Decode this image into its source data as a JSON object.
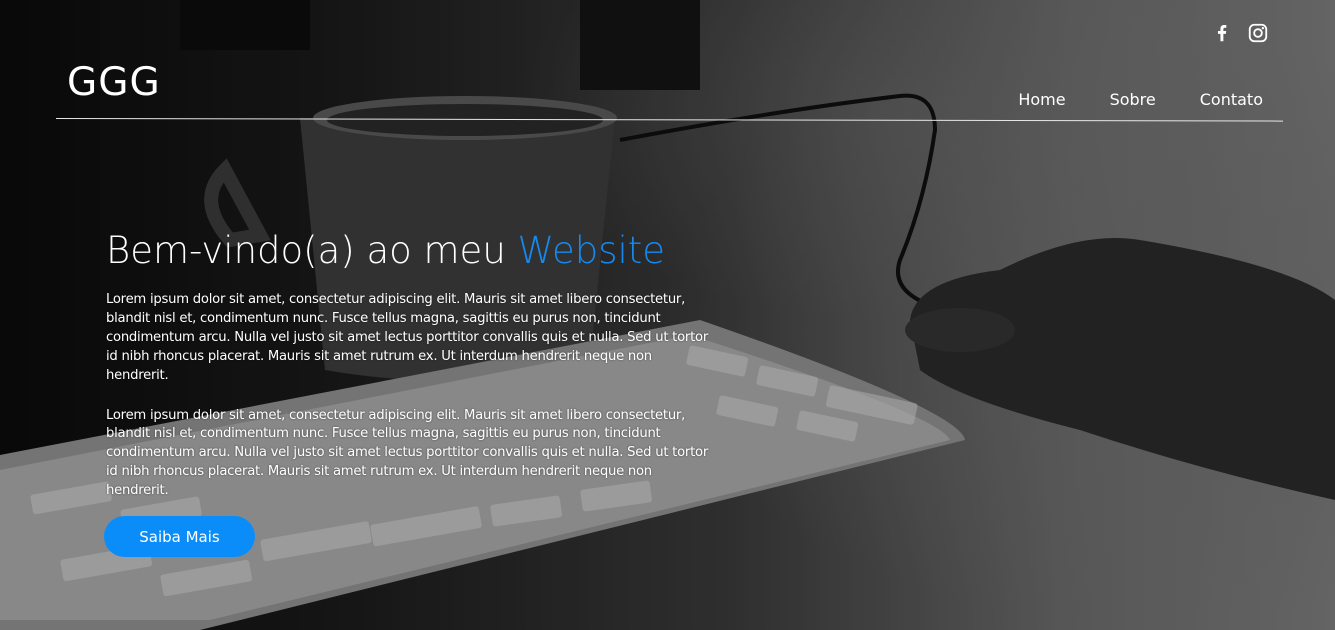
{
  "header": {
    "logo": "GGG",
    "nav": [
      {
        "label": "Home"
      },
      {
        "label": "Sobre"
      },
      {
        "label": "Contato"
      }
    ],
    "social": [
      {
        "icon": "facebook-icon"
      },
      {
        "icon": "instagram-icon"
      }
    ]
  },
  "hero": {
    "title_prefix": "Bem-vindo(a) ao meu ",
    "title_accent": "Website",
    "paragraphs": [
      "Lorem ipsum dolor sit amet, consectetur adipiscing elit. Mauris sit amet libero consectetur, blandit nisl et, condimentum nunc. Fusce tellus magna, sagittis eu purus non, tincidunt condimentum arcu. Nulla vel justo sit amet lectus porttitor convallis quis et nulla. Sed ut tortor id nibh rhoncus placerat. Mauris sit amet rutrum ex. Ut interdum hendrerit neque non hendrerit.",
      "Lorem ipsum dolor sit amet, consectetur adipiscing elit. Mauris sit amet libero consectetur, blandit nisl et, condimentum nunc. Fusce tellus magna, sagittis eu purus non, tincidunt condimentum arcu. Nulla vel justo sit amet lectus porttitor convallis quis et nulla. Sed ut tortor id nibh rhoncus placerat. Mauris sit amet rutrum ex. Ut interdum hendrerit neque non hendrerit."
    ],
    "cta_label": "Saiba Mais"
  },
  "colors": {
    "accent": "#1689f0",
    "button": "#0a8df8",
    "text": "#ffffff"
  }
}
